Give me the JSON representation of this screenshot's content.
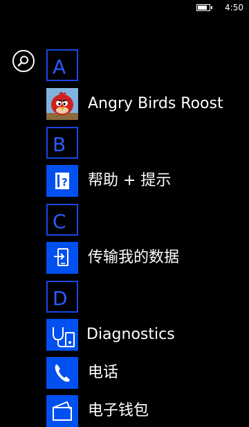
{
  "status": {
    "time": "4:50",
    "battery_level": 0.8
  },
  "search": {
    "icon": "search-icon"
  },
  "sections": [
    {
      "letter": "A",
      "apps": [
        {
          "label": "Angry Birds Roost",
          "icon": "angry-birds-icon"
        }
      ]
    },
    {
      "letter": "B",
      "apps": [
        {
          "label": "帮助 + 提示",
          "icon": "help-book-icon"
        }
      ]
    },
    {
      "letter": "C",
      "apps": [
        {
          "label": "传输我的数据",
          "icon": "transfer-phone-icon"
        }
      ]
    },
    {
      "letter": "D",
      "apps": [
        {
          "label": "Diagnostics",
          "icon": "stethoscope-icon"
        },
        {
          "label": "电话",
          "icon": "phone-icon"
        },
        {
          "label": "电子钱包",
          "icon": "wallet-icon"
        }
      ]
    }
  ],
  "colors": {
    "accent": "#0050ef",
    "letter_border": "#1a47e6",
    "letter_text": "#2a5cff",
    "background": "#000000"
  }
}
